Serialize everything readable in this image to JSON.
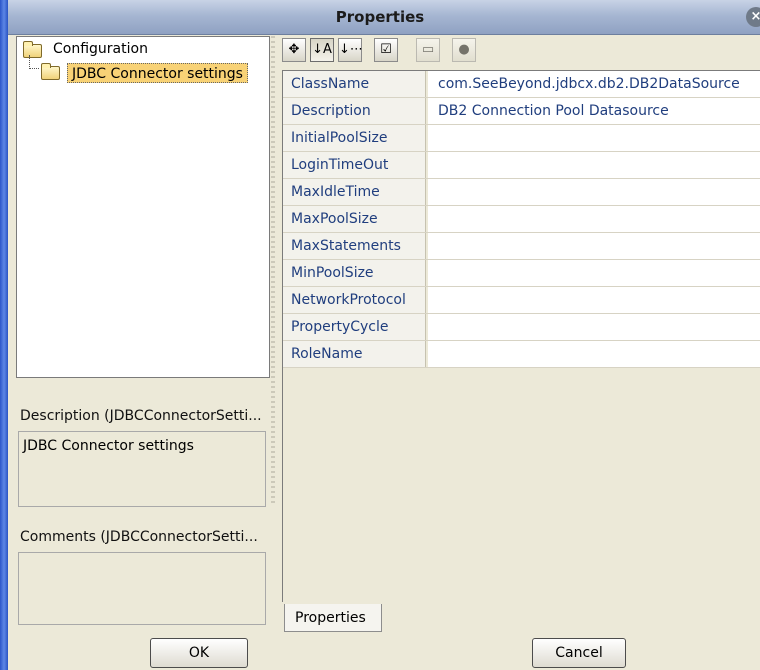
{
  "window": {
    "title": "Properties",
    "close_glyph": "×"
  },
  "tree": {
    "root_label": "Configuration",
    "child_label": "JDBC Connector settings"
  },
  "left_panel": {
    "description_label": "Description (JDBCConnectorSetti...",
    "description_value": "JDBC Connector settings",
    "comments_label": "Comments (JDBCConnectorSetti...",
    "comments_value": ""
  },
  "toolbar": {
    "icons": [
      {
        "name": "pin-icon",
        "glyph": "✥",
        "state": "normal"
      },
      {
        "name": "sort-az-icon",
        "glyph": "↓A",
        "state": "pressed"
      },
      {
        "name": "sort-category-icon",
        "glyph": "↓⋯",
        "state": "normal"
      },
      {
        "name": "checklist-icon",
        "glyph": "☑",
        "state": "normal"
      },
      {
        "name": "window-icon",
        "glyph": "▭",
        "state": "disabled"
      },
      {
        "name": "circle-icon",
        "glyph": "●",
        "state": "disabled"
      }
    ]
  },
  "properties": [
    {
      "name": "ClassName",
      "value": "com.SeeBeyond.jdbcx.db2.DB2DataSource"
    },
    {
      "name": "Description",
      "value": "DB2 Connection Pool Datasource"
    },
    {
      "name": "InitialPoolSize",
      "value": ""
    },
    {
      "name": "LoginTimeOut",
      "value": ""
    },
    {
      "name": "MaxIdleTime",
      "value": ""
    },
    {
      "name": "MaxPoolSize",
      "value": ""
    },
    {
      "name": "MaxStatements",
      "value": ""
    },
    {
      "name": "MinPoolSize",
      "value": ""
    },
    {
      "name": "NetworkProtocol",
      "value": ""
    },
    {
      "name": "PropertyCycle",
      "value": ""
    },
    {
      "name": "RoleName",
      "value": ""
    }
  ],
  "tab": {
    "label": "Properties"
  },
  "buttons": {
    "ok": "OK",
    "cancel": "Cancel"
  }
}
